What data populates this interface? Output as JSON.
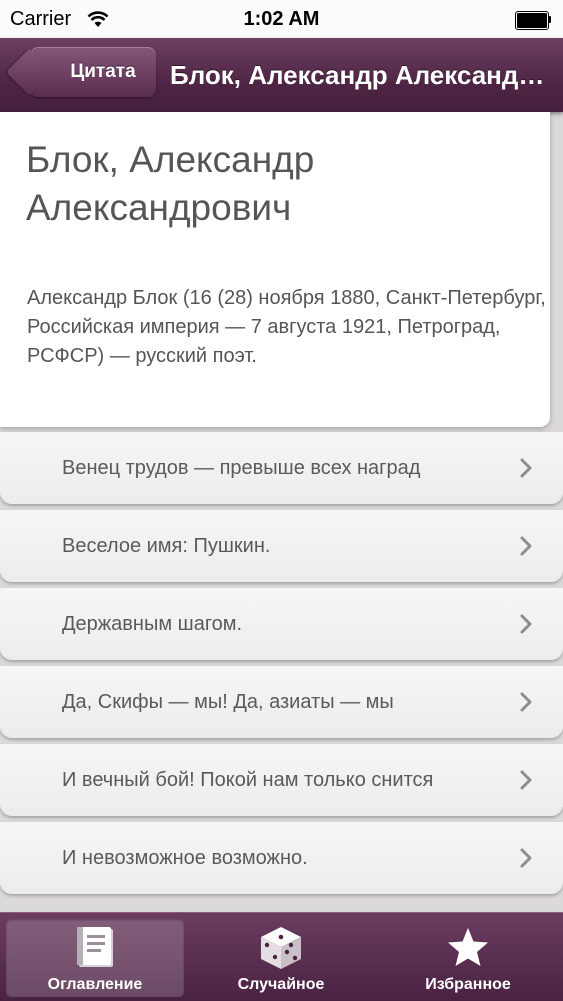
{
  "status_bar": {
    "carrier": "Carrier",
    "time": "1:02 AM",
    "wifi_icon": "wifi-icon",
    "battery_icon": "battery-icon"
  },
  "nav_bar": {
    "back_label": "Цитата",
    "title": "Блок, Александр Александрович"
  },
  "author": {
    "name": "Блок, Александр Александрович",
    "bio": "Александр Блок (16 (28) ноября 1880, Санкт-Петербург, Российская империя — 7 августа 1921, Петроград, РСФСР) — русский поэт."
  },
  "quotes": [
    {
      "text": "Венец трудов — превыше всех наград"
    },
    {
      "text": "Веселое имя: Пушкин."
    },
    {
      "text": "Державным шагом."
    },
    {
      "text": "Да, Скифы — мы! Да, азиаты — мы"
    },
    {
      "text": "И вечный бой! Покой нам только снится"
    },
    {
      "text": "И невозможное возможно."
    }
  ],
  "tab_bar": {
    "items": [
      {
        "label": "Оглавление",
        "icon": "book-icon",
        "selected": true
      },
      {
        "label": "Случайное",
        "icon": "dice-icon",
        "selected": false
      },
      {
        "label": "Избранное",
        "icon": "star-icon",
        "selected": false
      }
    ]
  },
  "colors": {
    "accent": "#5a2d50",
    "text": "#555555"
  }
}
